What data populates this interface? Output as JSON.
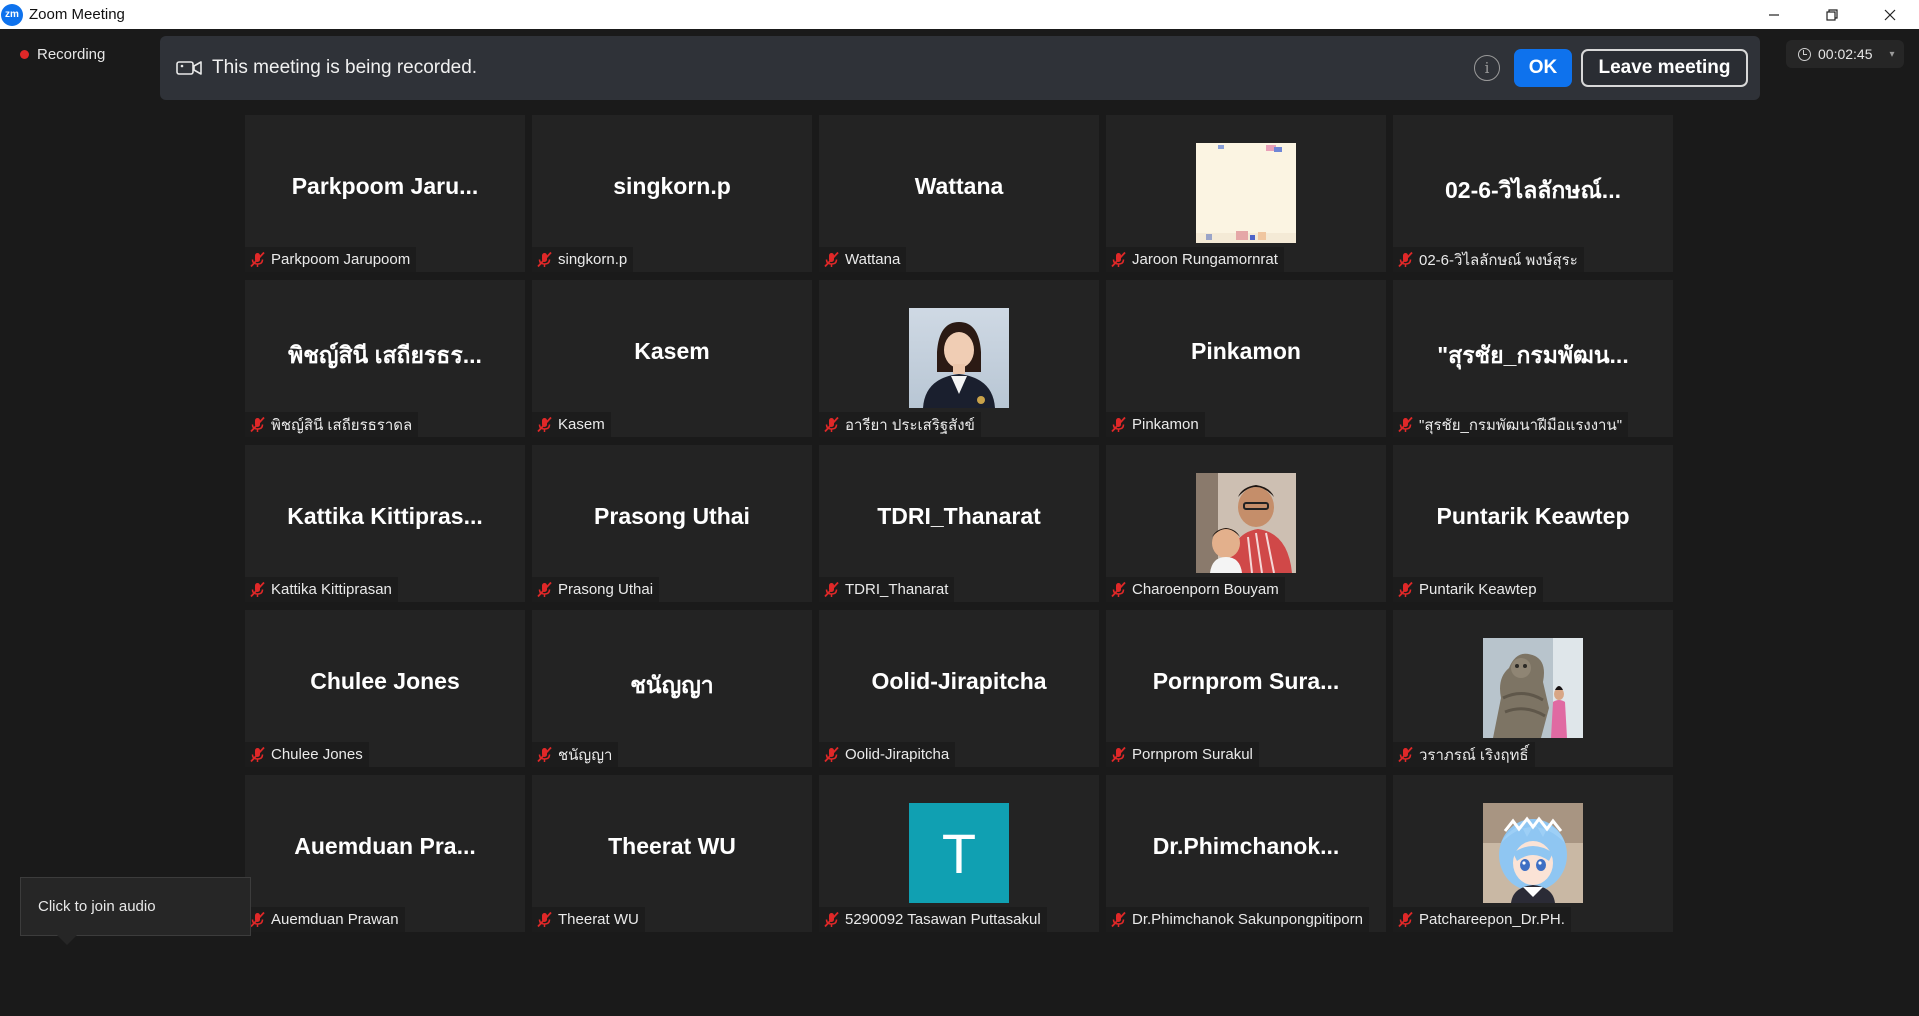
{
  "window": {
    "title": "Zoom Meeting",
    "logo_text": "zm",
    "controls": [
      "minimize",
      "restore",
      "close"
    ]
  },
  "recording_indicator": {
    "label": "Recording"
  },
  "timer": {
    "value": "00:02:45"
  },
  "banner": {
    "message": "This meeting is being recorded.",
    "info_glyph": "i",
    "ok_label": "OK",
    "leave_label": "Leave meeting"
  },
  "participants": [
    {
      "display": "Parkpoom Jaru...",
      "name": "Parkpoom Jarupoom"
    },
    {
      "display": "singkorn.p",
      "name": "singkorn.p"
    },
    {
      "display": "Wattana",
      "name": "Wattana"
    },
    {
      "display": "",
      "name": "Jaroon Rungamornrat",
      "avatar": "photo-document"
    },
    {
      "display": "02-6-วิไลลักษณ์...",
      "name": "02-6-วิไลลักษณ์ พงษ์สุระ"
    },
    {
      "display": "พิชญ์สินี เสถียรธร...",
      "name": "พิชญ์สินี เสถียรธราดล"
    },
    {
      "display": "Kasem",
      "name": "Kasem"
    },
    {
      "display": "",
      "name": "อารียา ประเสริฐสังข์",
      "avatar": "photo-woman"
    },
    {
      "display": "Pinkamon",
      "name": "Pinkamon"
    },
    {
      "display": "\"สุรชัย_กรมพัฒน...",
      "name": "\"สุรชัย_กรมพัฒนาฝีมือแรงงาน\""
    },
    {
      "display": "Kattika  Kittipras...",
      "name": "Kattika Kittiprasan"
    },
    {
      "display": "Prasong Uthai",
      "name": "Prasong Uthai"
    },
    {
      "display": "TDRI_Thanarat",
      "name": "TDRI_Thanarat"
    },
    {
      "display": "",
      "name": "Charoenporn Bouyam",
      "avatar": "photo-family"
    },
    {
      "display": "Puntarik Keawtep",
      "name": "Puntarik Keawtep"
    },
    {
      "display": "Chulee Jones",
      "name": "Chulee Jones"
    },
    {
      "display": "ชนัญญา",
      "name": "ชนัญญา"
    },
    {
      "display": "Oolid-Jirapitcha",
      "name": "Oolid-Jirapitcha"
    },
    {
      "display": "Pornprom Sura...",
      "name": "Pornprom Surakul"
    },
    {
      "display": "",
      "name": "วราภรณ์ เริงฤทธิ์",
      "avatar": "photo-statue"
    },
    {
      "display": "Auemduan  Pra...",
      "name": "Auemduan Prawan"
    },
    {
      "display": "Theerat WU",
      "name": "Theerat WU"
    },
    {
      "display": "T",
      "name": "5290092 Tasawan Puttasakul",
      "avatar": "letter"
    },
    {
      "display": "Dr.Phimchanok...",
      "name": "Dr.Phimchanok Sakunpongpitiporn"
    },
    {
      "display": "",
      "name": "Patchareepon_Dr.PH.",
      "avatar": "photo-anime"
    }
  ],
  "audio_tooltip": {
    "label": "Click to join audio"
  },
  "colors": {
    "background": "#1a1a1a",
    "tile": "#232323",
    "accent_blue": "#0e72ed",
    "recording_red": "#e02828",
    "muted_red": "#e02828",
    "letter_avatar": "#10a0b2"
  }
}
